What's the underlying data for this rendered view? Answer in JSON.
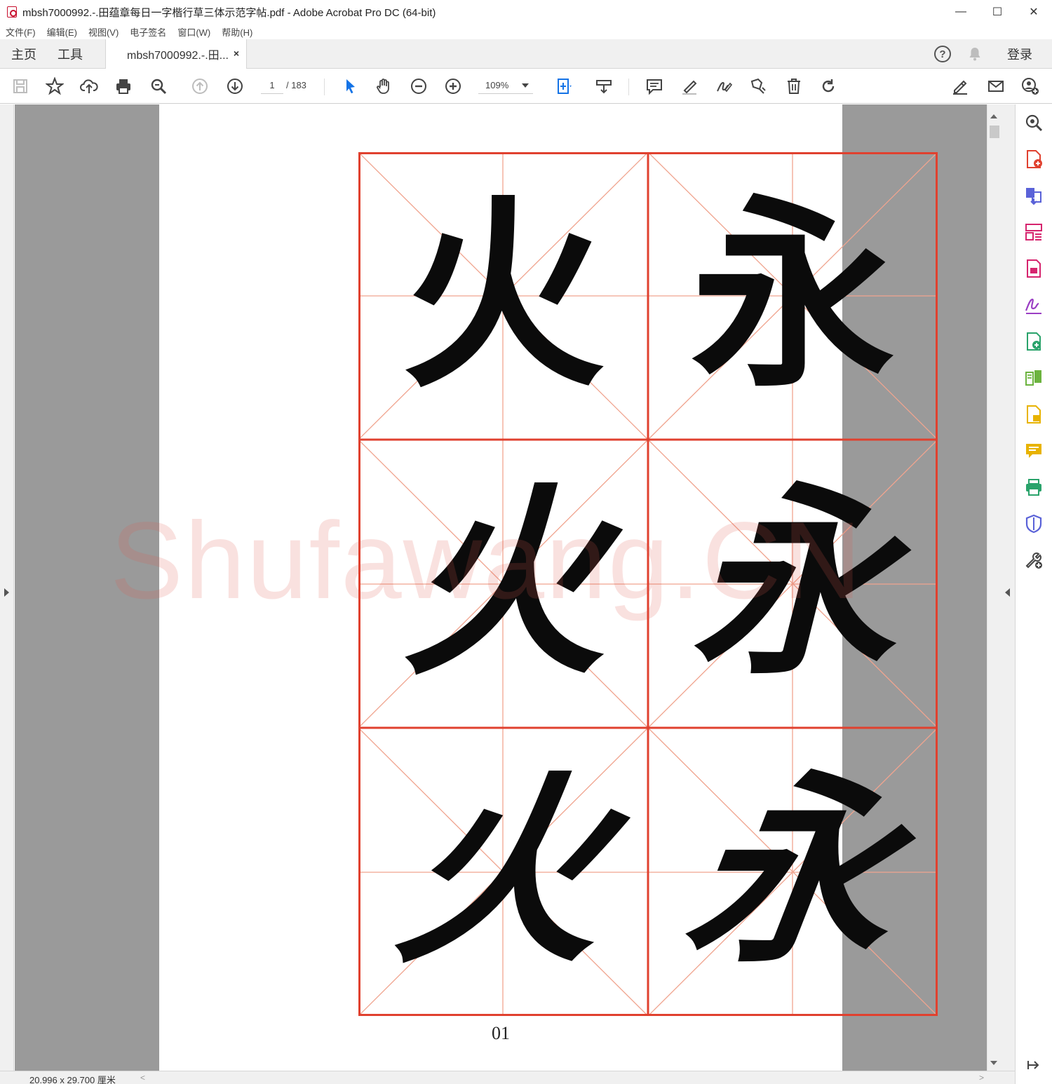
{
  "window": {
    "title": "mbsh7000992.-.田蕴章每日一字楷行草三体示范字帖.pdf - Adobe Acrobat Pro DC (64-bit)",
    "minimize": "—",
    "maximize": "☐",
    "close": "✕"
  },
  "menu": [
    "文件(F)",
    "编辑(E)",
    "视图(V)",
    "电子签名",
    "窗口(W)",
    "帮助(H)"
  ],
  "tabs": {
    "home": "主页",
    "tools": "工具",
    "document": "mbsh7000992.-.田...",
    "close": "×"
  },
  "account": {
    "help": "?",
    "login": "登录"
  },
  "toolbar": {
    "page_current": "1",
    "page_total": "/ 183",
    "zoom": "109%"
  },
  "document": {
    "characters": [
      "火",
      "永",
      "火",
      "永",
      "火",
      "永"
    ],
    "page_number": "01",
    "watermark": "Shufawang.CN"
  },
  "status": {
    "page_size": "20.996 x 29.700 厘米",
    "scroll_left": "<",
    "scroll_right": ">"
  },
  "colors": {
    "grid_red": "#e0412f",
    "grid_guide": "#f0a48f",
    "workspace_gray": "#9a9a9a",
    "select_blue": "#1473e6"
  },
  "icons": {
    "toolbar": [
      "save-icon",
      "bookmark-star-icon",
      "upload-cloud-icon",
      "print-icon",
      "zoom-search-icon",
      "prev-page-icon",
      "next-page-icon",
      "select-cursor-icon",
      "hand-icon",
      "zoom-out-icon",
      "zoom-in-icon",
      "page-fit-icon",
      "read-mode-icon",
      "comment-icon",
      "highlight-icon",
      "sign-icon",
      "stamp-icon",
      "delete-icon",
      "rotate-icon",
      "share-link-icon",
      "email-icon",
      "add-user-icon"
    ],
    "panel": [
      "search-zoom-icon",
      "create-pdf-icon",
      "combine-files-icon",
      "organize-pages-icon",
      "export-pdf-icon",
      "fill-sign-icon",
      "edit-pdf-icon",
      "compare-icon",
      "send-for-comments-icon",
      "comment-panel-icon",
      "print-production-icon",
      "protect-icon",
      "more-tools-icon",
      "collapse-panel-icon"
    ]
  }
}
